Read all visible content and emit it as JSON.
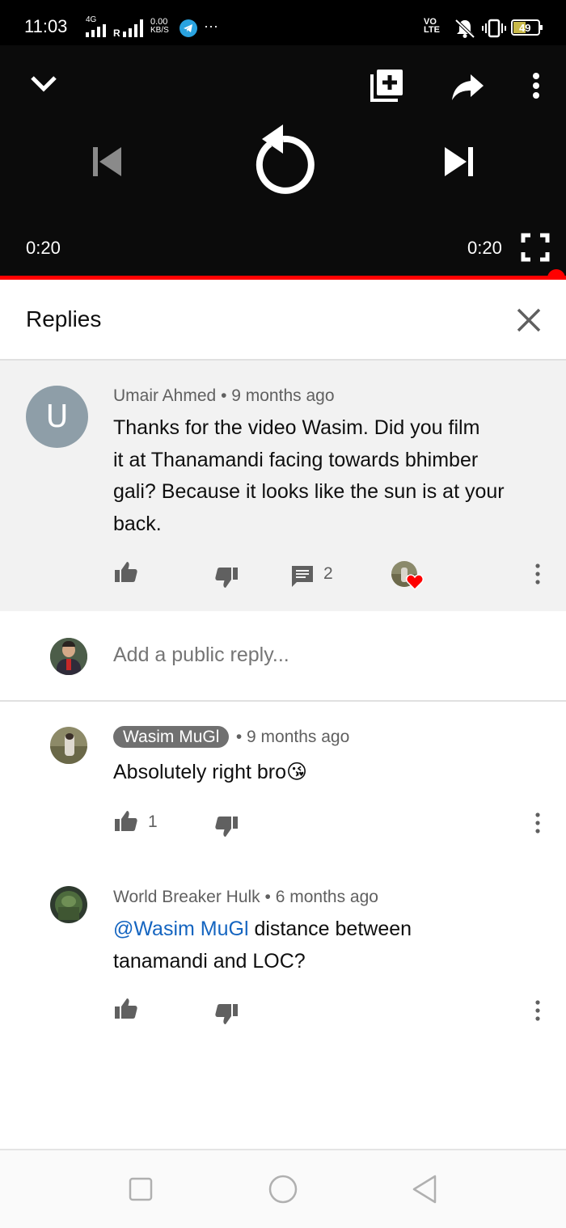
{
  "status_bar": {
    "time": "11:03",
    "net_4g": "4G",
    "roaming": "R",
    "speed_value": "0.00",
    "speed_unit": "KB/S",
    "more": "···",
    "volte_top": "VO",
    "volte_bottom": "LTE",
    "battery": "49"
  },
  "player": {
    "elapsed": "0:20",
    "duration": "0:20",
    "progress_fraction": 1.0,
    "accent_color": "#ff0000"
  },
  "replies_header": {
    "title": "Replies"
  },
  "parent_comment": {
    "author": "Umair Ahmed",
    "avatar_letter": "U",
    "age": "• 9 months ago",
    "text_lines": [
      "Thanks for the video Wasim. Did you film",
      "it at Thanamandi facing towards bhimber",
      "gali? Because it looks like the sun is at your",
      "back."
    ],
    "reply_count": "2"
  },
  "add_reply": {
    "placeholder": "Add a public reply..."
  },
  "replies": [
    {
      "author": "Wasim MuGl",
      "age": "• 9 months ago",
      "text": "Absolutely right bro",
      "emoji": "😘",
      "like_count": "1"
    },
    {
      "author": "World Breaker Hulk",
      "age": "• 6 months ago",
      "mention": "@Wasim MuGl",
      "text_rest": " distance between",
      "text_line2": "tanamandi and LOC?"
    }
  ]
}
